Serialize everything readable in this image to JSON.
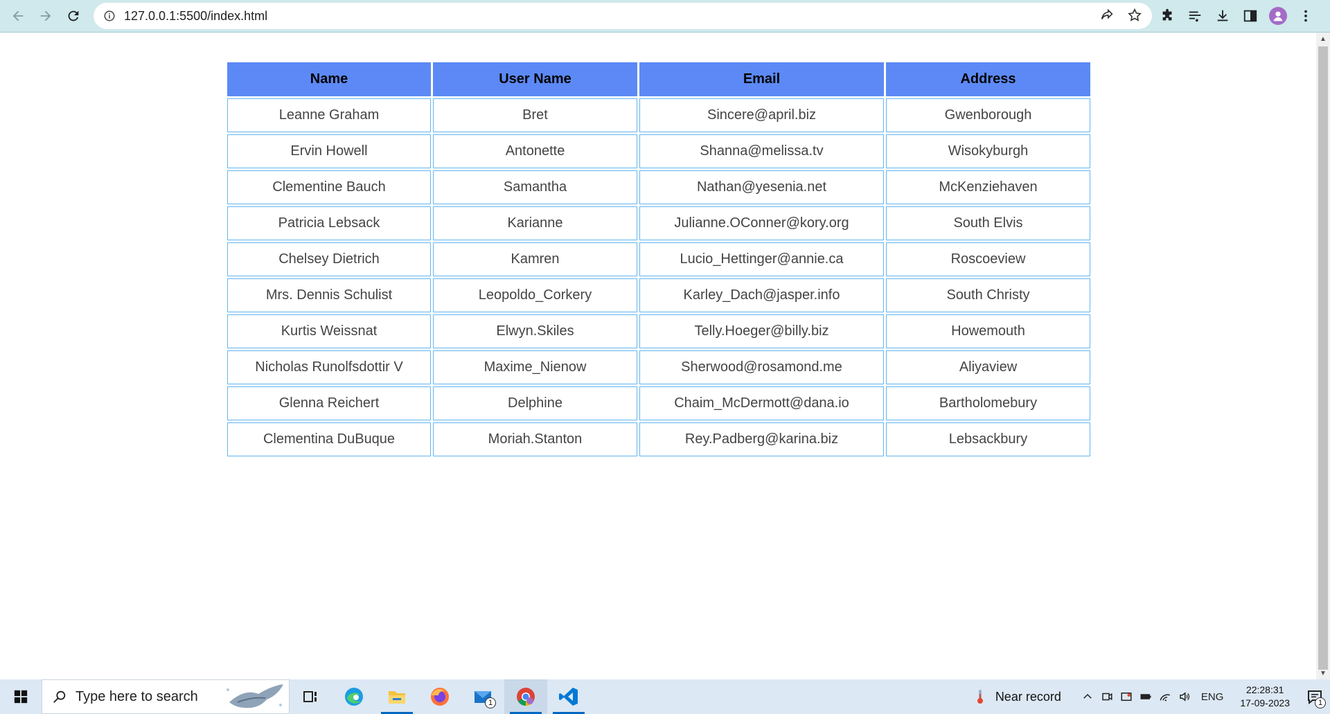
{
  "browser": {
    "url": "127.0.0.1:5500/index.html"
  },
  "table": {
    "headers": [
      "Name",
      "User Name",
      "Email",
      "Address"
    ],
    "rows": [
      [
        "Leanne Graham",
        "Bret",
        "Sincere@april.biz",
        "Gwenborough"
      ],
      [
        "Ervin Howell",
        "Antonette",
        "Shanna@melissa.tv",
        "Wisokyburgh"
      ],
      [
        "Clementine Bauch",
        "Samantha",
        "Nathan@yesenia.net",
        "McKenziehaven"
      ],
      [
        "Patricia Lebsack",
        "Karianne",
        "Julianne.OConner@kory.org",
        "South Elvis"
      ],
      [
        "Chelsey Dietrich",
        "Kamren",
        "Lucio_Hettinger@annie.ca",
        "Roscoeview"
      ],
      [
        "Mrs. Dennis Schulist",
        "Leopoldo_Corkery",
        "Karley_Dach@jasper.info",
        "South Christy"
      ],
      [
        "Kurtis Weissnat",
        "Elwyn.Skiles",
        "Telly.Hoeger@billy.biz",
        "Howemouth"
      ],
      [
        "Nicholas Runolfsdottir V",
        "Maxime_Nienow",
        "Sherwood@rosamond.me",
        "Aliyaview"
      ],
      [
        "Glenna Reichert",
        "Delphine",
        "Chaim_McDermott@dana.io",
        "Bartholomebury"
      ],
      [
        "Clementina DuBuque",
        "Moriah.Stanton",
        "Rey.Padberg@karina.biz",
        "Lebsackbury"
      ]
    ]
  },
  "taskbar": {
    "search_placeholder": "Type here to search",
    "mail_badge": "1",
    "weather_text": "Near record",
    "language": "ENG",
    "time": "22:28:31",
    "date": "17-09-2023",
    "notification_badge": "1"
  },
  "colors": {
    "header_bg": "#5c89f5",
    "cell_border": "#63b6f0",
    "toolbar_bg": "#cfe9ec"
  }
}
